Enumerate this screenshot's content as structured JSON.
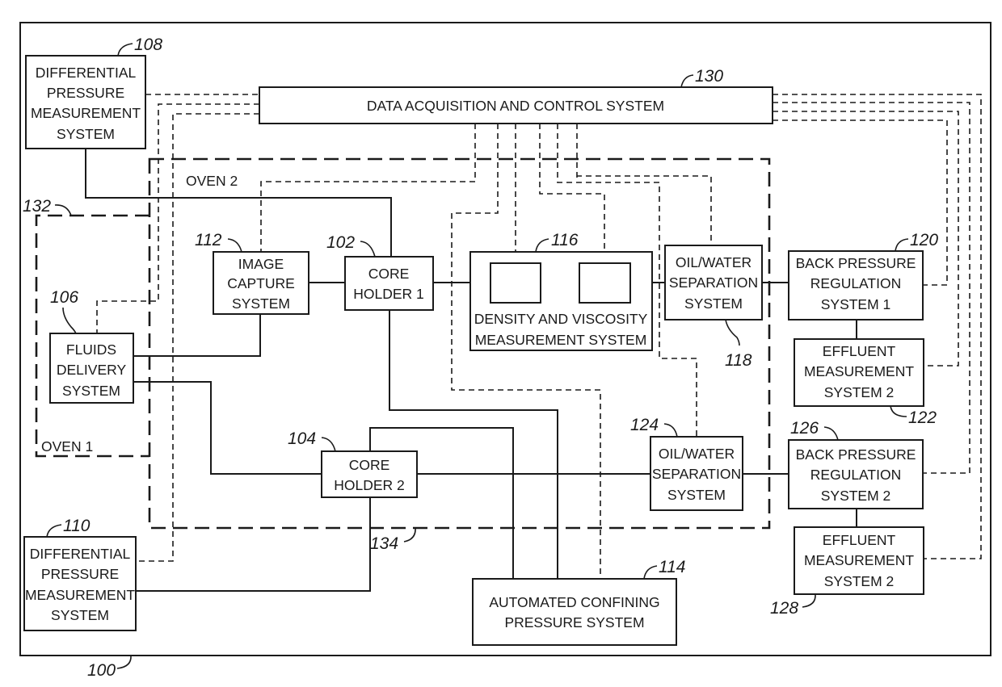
{
  "figure": {
    "system_ref": "100",
    "components": {
      "daq": {
        "ref": "130",
        "lines": [
          "DATA ACQUISITION AND CONTROL SYSTEM"
        ]
      },
      "dp1": {
        "ref": "108",
        "lines": [
          "DIFFERENTIAL",
          "PRESSURE",
          "MEASUREMENT",
          "SYSTEM"
        ]
      },
      "dp2": {
        "ref": "110",
        "lines": [
          "DIFFERENTIAL",
          "PRESSURE",
          "MEASUREMENT",
          "SYSTEM"
        ]
      },
      "fluids": {
        "ref": "106",
        "lines": [
          "FLUIDS",
          "DELIVERY",
          "SYSTEM"
        ]
      },
      "image": {
        "ref": "112",
        "lines": [
          "IMAGE",
          "CAPTURE",
          "SYSTEM"
        ]
      },
      "core1": {
        "ref": "102",
        "lines": [
          "CORE",
          "HOLDER 1"
        ]
      },
      "core2": {
        "ref": "104",
        "lines": [
          "CORE",
          "HOLDER 2"
        ]
      },
      "density": {
        "ref": "116",
        "lines": [
          "DENSITY AND VISCOSITY",
          "MEASUREMENT SYSTEM"
        ]
      },
      "ows1": {
        "ref": "118",
        "lines": [
          "OIL/WATER",
          "SEPARATION",
          "SYSTEM"
        ]
      },
      "ows2": {
        "ref": "124",
        "lines": [
          "OIL/WATER",
          "SEPARATION",
          "SYSTEM"
        ]
      },
      "bpr1": {
        "ref": "120",
        "lines": [
          "BACK PRESSURE",
          "REGULATION",
          "SYSTEM 1"
        ]
      },
      "bpr2": {
        "ref": "126",
        "lines": [
          "BACK PRESSURE",
          "REGULATION",
          "SYSTEM 2"
        ]
      },
      "eff1": {
        "ref": "122",
        "lines": [
          "EFFLUENT",
          "MEASUREMENT",
          "SYSTEM 2"
        ]
      },
      "eff2": {
        "ref": "128",
        "lines": [
          "EFFLUENT",
          "MEASUREMENT",
          "SYSTEM 2"
        ]
      },
      "acps": {
        "ref": "114",
        "lines": [
          "AUTOMATED CONFINING",
          "PRESSURE SYSTEM"
        ]
      }
    },
    "enclosures": {
      "oven1": {
        "ref": "132",
        "label": "OVEN 1"
      },
      "oven2": {
        "ref": "134",
        "label": "OVEN 2"
      }
    },
    "colors": {
      "ink": "#1a1a1a",
      "paper": "#ffffff"
    }
  }
}
